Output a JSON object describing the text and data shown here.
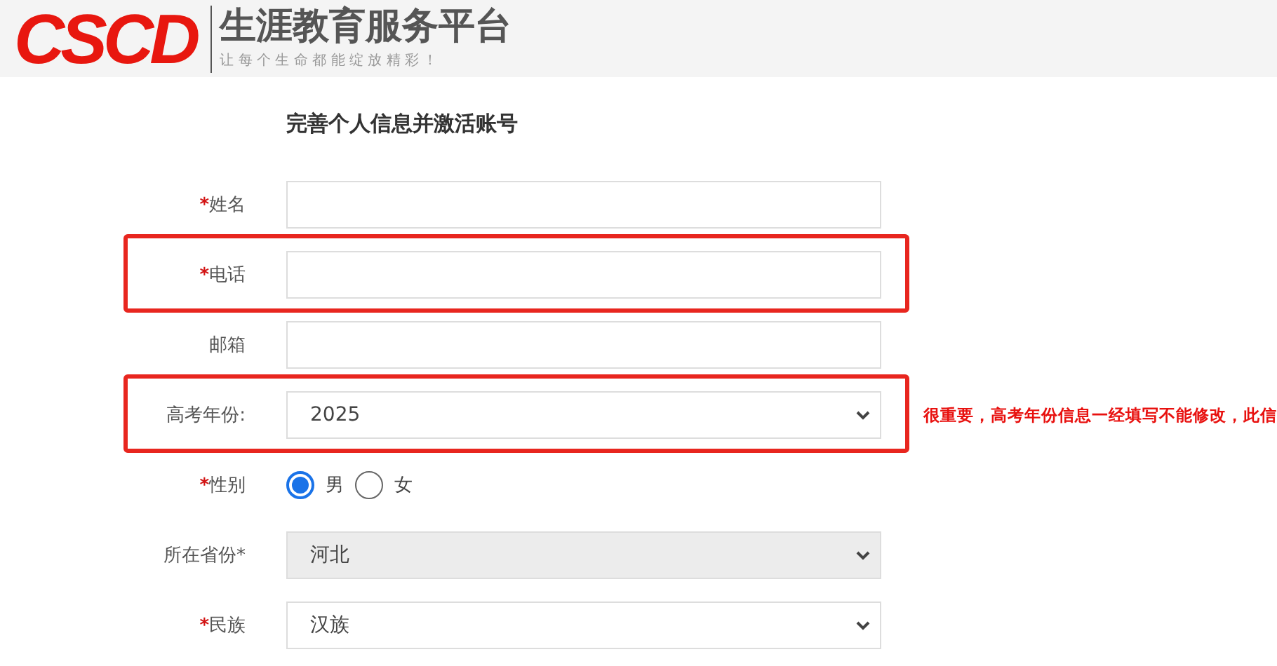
{
  "header": {
    "logo": "CSCD",
    "title": "生涯教育服务平台",
    "tagline": "让 每 个 生 命 都 能 绽 放 精 彩 ！"
  },
  "form_title": "完善个人信息并激活账号",
  "fields": [
    {
      "kind": "text",
      "label": "姓名",
      "required_mark": "*",
      "highlighted": false
    },
    {
      "kind": "text",
      "label": "电话",
      "required_mark": "*",
      "highlighted": true
    },
    {
      "kind": "text",
      "label": "邮箱",
      "highlighted": false
    },
    {
      "kind": "select",
      "label": "高考年份:",
      "highlighted": true,
      "value": "2025",
      "disabled": false,
      "note": "很重要，高考年份信息一经填写不能修改，此信"
    },
    {
      "kind": "radio",
      "label": "性别",
      "required_mark": "*",
      "highlighted": false,
      "options": [
        {
          "label": "男",
          "selected": true
        },
        {
          "label": "女",
          "selected": false
        }
      ]
    },
    {
      "kind": "select",
      "label": "所在省份*",
      "highlighted": false,
      "value": "河北",
      "disabled": true
    },
    {
      "kind": "select",
      "label": "民族",
      "required_mark": "*",
      "highlighted": false,
      "value": "汉族",
      "disabled": false
    }
  ]
}
